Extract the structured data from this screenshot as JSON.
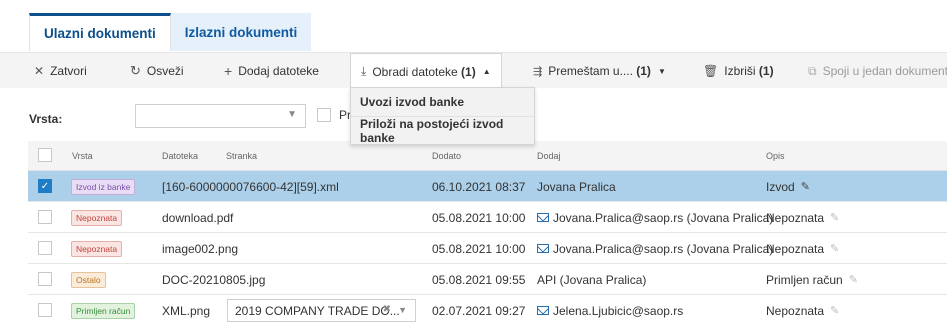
{
  "tabs": [
    {
      "label": "Ulazni dokumenti",
      "active": true
    },
    {
      "label": "Izlazni dokumenti",
      "active": false
    }
  ],
  "toolbar": {
    "close": {
      "icon": "close-icon",
      "label": "Zatvori"
    },
    "refresh": {
      "icon": "refresh-icon",
      "label": "Osveži"
    },
    "add": {
      "icon": "plus-icon",
      "label": "Dodaj datoteke"
    },
    "process": {
      "icon": "process-icon",
      "label": "Obradi datoteke",
      "count": "(1)"
    },
    "move": {
      "icon": "move-icon",
      "label": "Premeštam u....",
      "count": "(1)"
    },
    "delete": {
      "icon": "trash-icon",
      "label": "Izbriši",
      "count": "(1)"
    },
    "merge": {
      "icon": "merge-icon",
      "label": "Spoji u jedan dokument"
    }
  },
  "dropdown": {
    "items": [
      "Uvozi izvod banke",
      "Priloži na postojeći izvod banke"
    ]
  },
  "filter": {
    "label": "Vrsta:",
    "select_value": "",
    "check_label": "Pr"
  },
  "table": {
    "headers": {
      "type": "Vrsta",
      "file": "Datoteka",
      "party": "Stranka",
      "added": "Dodato",
      "by": "Dodaj",
      "desc": "Opis"
    },
    "rows": [
      {
        "selected": true,
        "badge": "Izvod iz banke",
        "badge_color": "#7b4fa8",
        "badge_bg": "#e9ddf5",
        "file": "[160-6000000076600-42][59].xml",
        "party": "",
        "added": "06.10.2021 08:37",
        "by": "Jovana Pralica",
        "by_mail": false,
        "desc": "Izvod"
      },
      {
        "selected": false,
        "badge": "Nepoznata",
        "badge_color": "#c0453d",
        "badge_bg": "#fbe5e3",
        "file": "download.pdf",
        "party": "",
        "added": "05.08.2021 10:00",
        "by": "Jovana.Pralica@saop.rs (Jovana Pralica)",
        "by_mail": true,
        "desc": "Nepoznata"
      },
      {
        "selected": false,
        "badge": "Nepoznata",
        "badge_color": "#c0453d",
        "badge_bg": "#fbe5e3",
        "file": "image002.png",
        "party": "",
        "added": "05.08.2021 10:00",
        "by": "Jovana.Pralica@saop.rs (Jovana Pralica)",
        "by_mail": true,
        "desc": "Nepoznata"
      },
      {
        "selected": false,
        "badge": "Ostalo",
        "badge_color": "#b8731e",
        "badge_bg": "#fbecd9",
        "file": "DOC-20210805.jpg",
        "party": "",
        "added": "05.08.2021 09:55",
        "by": "API (Jovana Pralica)",
        "by_mail": false,
        "desc": "Primljen račun"
      },
      {
        "selected": false,
        "badge": "Primljen račun",
        "badge_color": "#3d8a3f",
        "badge_bg": "#e1f3dd",
        "file": "XML.png",
        "party": "2019 COMPANY TRADE DO...",
        "added": "02.07.2021 09:27",
        "by": "Jelena.Ljubicic@saop.rs",
        "by_mail": true,
        "desc": "Nepoznata"
      }
    ]
  },
  "colors": {
    "accent": "#0c4f8a",
    "selected_row": "#acd0ea",
    "checkbox_checked": "#1f7cc6"
  }
}
